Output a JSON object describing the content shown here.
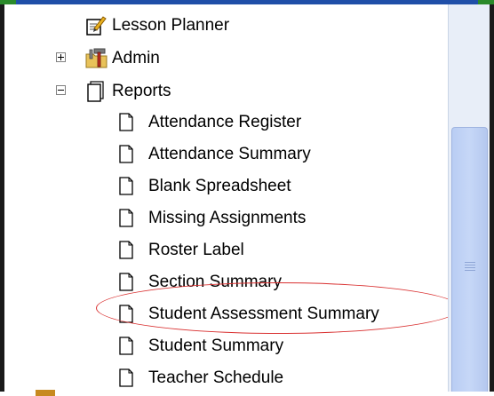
{
  "tree": {
    "lesson_planner": "Lesson Planner",
    "admin": "Admin",
    "reports": "Reports",
    "report_items": [
      "Attendance Register",
      "Attendance Summary",
      "Blank Spreadsheet",
      "Missing Assignments",
      "Roster Label",
      "Section Summary",
      "Student Assessment Summary",
      "Student Summary",
      "Teacher Schedule"
    ]
  },
  "highlight_color": "#d93030",
  "accent": "#1f4fa8"
}
